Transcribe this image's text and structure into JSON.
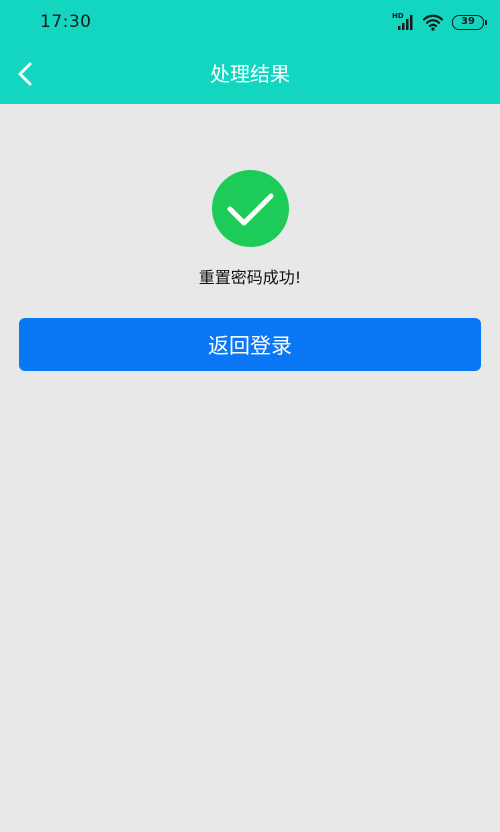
{
  "status_bar": {
    "time": "17:30",
    "network_label": "HD",
    "battery_level": "39"
  },
  "header": {
    "title": "处理结果",
    "back_icon": "chevron-left-icon"
  },
  "result": {
    "icon": "check-circle-icon",
    "message": "重置密码成功!"
  },
  "actions": {
    "return_login_label": "返回登录"
  },
  "colors": {
    "header_bg": "#12d6c0",
    "page_bg": "#e8e8e8",
    "success_green": "#1dcb58",
    "button_blue": "#0a78f5"
  }
}
